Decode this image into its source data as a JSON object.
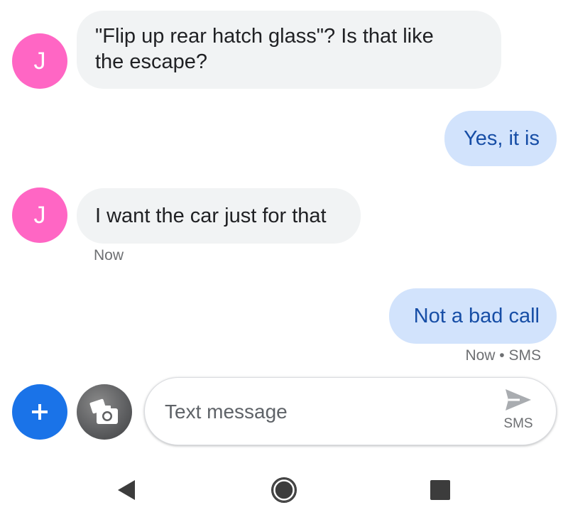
{
  "conversation": {
    "messages": [
      {
        "direction": "incoming",
        "avatar_letter": "J",
        "lines": [
          "\"Flip up rear hatch glass\"? Is that like",
          "the escape?"
        ]
      },
      {
        "direction": "outgoing",
        "text": "Yes, it is"
      },
      {
        "direction": "incoming",
        "avatar_letter": "J",
        "text": "I want the car just for that",
        "timestamp": "Now"
      },
      {
        "direction": "outgoing",
        "text": "Not a bad call",
        "status": "Now • SMS"
      }
    ]
  },
  "compose": {
    "placeholder": "Text message",
    "send_label": "SMS",
    "add_icon": "plus-icon",
    "camera_icon": "camera-gallery-icon",
    "send_icon": "send-arrow-icon"
  },
  "nav": {
    "back_icon": "back-triangle-icon",
    "home_icon": "home-circle-icon",
    "recents_icon": "recents-square-icon"
  },
  "colors": {
    "avatar": "#ff66c4",
    "incoming_bubble": "#f1f3f4",
    "outgoing_bubble": "#d2e3fc",
    "outgoing_text": "#174ea6",
    "fab": "#1a73e8"
  }
}
